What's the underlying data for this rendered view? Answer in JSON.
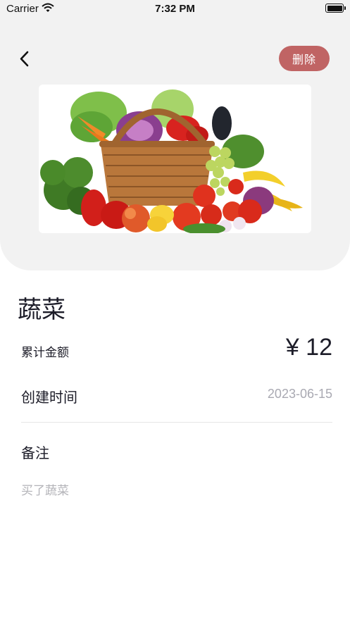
{
  "status_bar": {
    "carrier": "Carrier",
    "time": "7:32 PM"
  },
  "header": {
    "back_icon": "chevron-left-icon",
    "delete_label": "删除",
    "delete_color": "#c06464",
    "panel_color": "#f2f2f2",
    "image_icon": "vegetable-basket-image"
  },
  "detail": {
    "title": "蔬菜",
    "amount_label": "累计金额",
    "amount_value": "¥ 12",
    "created_label": "创建时间",
    "created_value": "2023-06-15",
    "note_label": "备注",
    "note_value": "买了蔬菜"
  }
}
